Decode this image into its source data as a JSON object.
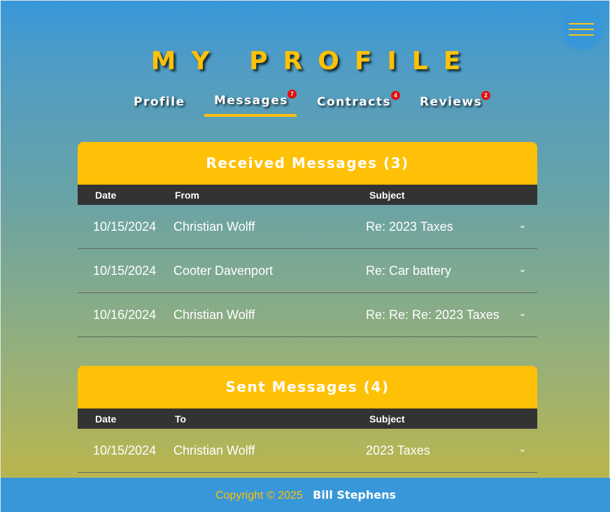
{
  "menu": {
    "icon": "hamburger-icon"
  },
  "page": {
    "title": "MY PROFILE"
  },
  "tabs": [
    {
      "label": "Profile",
      "badge": null,
      "active": false
    },
    {
      "label": "Messages",
      "badge": "7",
      "active": true
    },
    {
      "label": "Contracts",
      "badge": "4",
      "active": false
    },
    {
      "label": "Reviews",
      "badge": "2",
      "active": false
    }
  ],
  "received": {
    "title": "Received Messages (3)",
    "headers": {
      "date": "Date",
      "party": "From",
      "subject": "Subject"
    },
    "rows": [
      {
        "date": "10/15/2024",
        "name": "Christian Wolff",
        "subject": "Re: 2023 Taxes",
        "chevron": "chevron-down-icon"
      },
      {
        "date": "10/15/2024",
        "name": "Cooter Davenport",
        "subject": "Re: Car battery",
        "chevron": "chevron-down-icon"
      },
      {
        "date": "10/16/2024",
        "name": "Christian Wolff",
        "subject": "Re: Re: Re: 2023 Taxes",
        "chevron": "chevron-down-icon"
      }
    ]
  },
  "sent": {
    "title": "Sent Messages (4)",
    "headers": {
      "date": "Date",
      "party": "To",
      "subject": "Subject"
    },
    "rows": [
      {
        "date": "10/15/2024",
        "name": "Christian Wolff",
        "subject": "2023 Taxes",
        "chevron": "chevron-down-icon"
      }
    ]
  },
  "footer": {
    "copyright": "Copyright © 2025",
    "author": "Bill Stephens"
  },
  "colors": {
    "accent": "#ffc107",
    "primary": "#3897d8",
    "header_dark": "#333333",
    "badge": "#e01010"
  }
}
